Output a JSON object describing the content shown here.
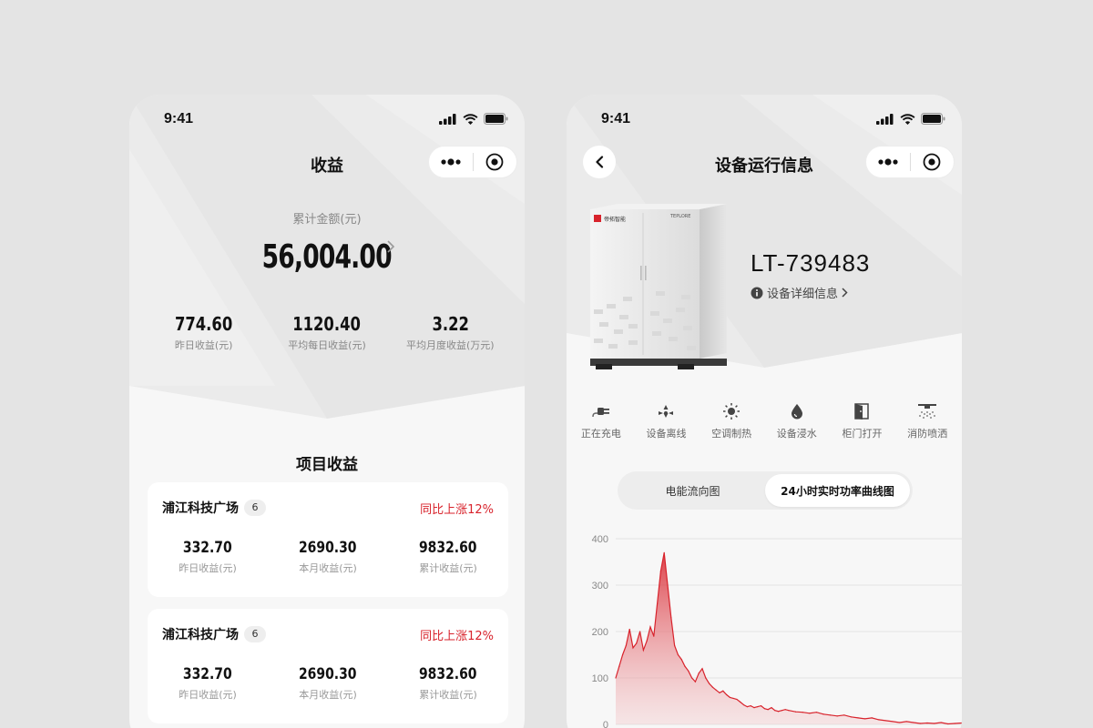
{
  "status_bar": {
    "time": "9:41"
  },
  "earnings_screen": {
    "title": "收益",
    "total_label": "累计金额(元)",
    "total_amount": "56,004.00",
    "stats": [
      {
        "value": "774.60",
        "label": "昨日收益(元)"
      },
      {
        "value": "1120.40",
        "label": "平均每日收益(元)"
      },
      {
        "value": "3.22",
        "label": "平均月度收益(万元)"
      }
    ],
    "section_title": "项目收益",
    "projects": [
      {
        "name": "浦江科技广场",
        "count": "6",
        "trend": "同比上涨12%",
        "stats": [
          {
            "value": "332.70",
            "label": "昨日收益(元)"
          },
          {
            "value": "2690.30",
            "label": "本月收益(元)"
          },
          {
            "value": "9832.60",
            "label": "累计收益(元)"
          }
        ]
      },
      {
        "name": "浦江科技广场",
        "count": "6",
        "trend": "同比上涨12%",
        "stats": [
          {
            "value": "332.70",
            "label": "昨日收益(元)"
          },
          {
            "value": "2690.30",
            "label": "本月收益(元)"
          },
          {
            "value": "9832.60",
            "label": "累计收益(元)"
          }
        ]
      }
    ]
  },
  "device_screen": {
    "title": "设备运行信息",
    "device_id": "LT-739483",
    "detail_link": "设备详细信息",
    "cabinet_brand": "帝拓智能",
    "cabinet_model": "TEPLORE",
    "status_items": [
      {
        "label": "正在充电",
        "icon": "plug-icon"
      },
      {
        "label": "设备离线",
        "icon": "offline-icon"
      },
      {
        "label": "空调制热",
        "icon": "sun-icon"
      },
      {
        "label": "设备浸水",
        "icon": "water-drop-icon"
      },
      {
        "label": "柜门打开",
        "icon": "door-open-icon"
      },
      {
        "label": "消防喷洒",
        "icon": "sprinkler-icon"
      }
    ],
    "tabs": [
      {
        "label": "电能流向图",
        "active": false
      },
      {
        "label": "24小时实时功率曲线图",
        "active": true
      }
    ]
  },
  "colors": {
    "accent": "#d8232c",
    "chart_fill": "#e8868c",
    "chart_line": "#d8232c"
  },
  "chart_data": {
    "type": "area",
    "y_ticks": [
      "400",
      "300",
      "200",
      "100",
      "0"
    ],
    "ylim": [
      0,
      400
    ],
    "xlim": [
      0,
      100
    ],
    "x": [
      0,
      1,
      2,
      3,
      4,
      5,
      6,
      7,
      8,
      9,
      10,
      11,
      12,
      13,
      14,
      15,
      16,
      17,
      18,
      19,
      20,
      21,
      22,
      23,
      24,
      25,
      26,
      27,
      28,
      29,
      30,
      31,
      32,
      33,
      34,
      35,
      36,
      37,
      38,
      39,
      40,
      41,
      42,
      43,
      44,
      45,
      46,
      47,
      48,
      49,
      50,
      52,
      54,
      56,
      58,
      60,
      62,
      64,
      66,
      68,
      70,
      72,
      74,
      76,
      78,
      80,
      82,
      84,
      86,
      88,
      90,
      92,
      94,
      96,
      98,
      100
    ],
    "values": [
      100,
      125,
      150,
      170,
      205,
      165,
      175,
      200,
      160,
      180,
      210,
      190,
      260,
      330,
      370,
      300,
      230,
      170,
      150,
      140,
      125,
      115,
      100,
      92,
      110,
      120,
      100,
      88,
      80,
      74,
      68,
      72,
      64,
      58,
      56,
      54,
      48,
      42,
      38,
      40,
      36,
      38,
      40,
      34,
      32,
      36,
      30,
      28,
      30,
      32,
      30,
      27,
      26,
      24,
      26,
      22,
      20,
      18,
      20,
      16,
      14,
      12,
      14,
      10,
      8,
      6,
      4,
      6,
      4,
      2,
      3,
      2,
      4,
      1,
      2,
      3
    ]
  }
}
